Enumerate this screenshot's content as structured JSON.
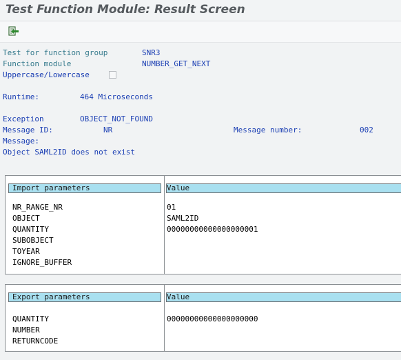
{
  "window": {
    "title": "Test Function Module: Result Screen"
  },
  "toolbar": {
    "icon": "execute-test-icon"
  },
  "info": {
    "function_group_label": "Test for function group",
    "function_group_value": "SNR3",
    "function_module_label": "Function module",
    "function_module_value": "NUMBER_GET_NEXT",
    "case_label": "Uppercase/Lowercase",
    "runtime_label": "Runtime:",
    "runtime_value": "464 Microseconds",
    "exception_label": "Exception",
    "exception_value": "OBJECT_NOT_FOUND",
    "message_id_label": "Message ID:",
    "message_id_value": "NR",
    "message_number_label": "Message number:",
    "message_number_value": "002",
    "message_label": "Message:",
    "message_text": "Object SAML2ID does not exist"
  },
  "import_params": {
    "header_name": "Import parameters",
    "header_value": "Value",
    "rows": [
      {
        "name": "NR_RANGE_NR",
        "value": "01"
      },
      {
        "name": "OBJECT",
        "value": "SAML2ID"
      },
      {
        "name": "QUANTITY",
        "value": "00000000000000000001"
      },
      {
        "name": "SUBOBJECT",
        "value": ""
      },
      {
        "name": "TOYEAR",
        "value": ""
      },
      {
        "name": "IGNORE_BUFFER",
        "value": ""
      }
    ]
  },
  "export_params": {
    "header_name": "Export parameters",
    "header_value": "Value",
    "rows": [
      {
        "name": "QUANTITY",
        "value": "00000000000000000000"
      },
      {
        "name": "NUMBER",
        "value": ""
      },
      {
        "name": "RETURNCODE",
        "value": ""
      }
    ]
  },
  "colors": {
    "label_teal": "#357a8c",
    "value_blue": "#1a3eb3",
    "header_cyan": "#a9e0f0"
  }
}
